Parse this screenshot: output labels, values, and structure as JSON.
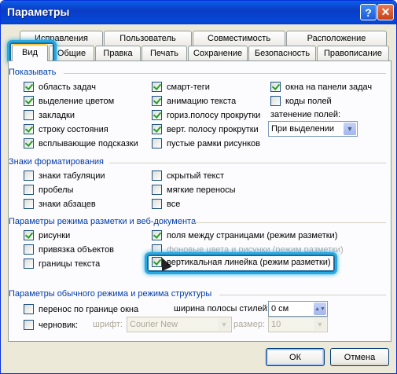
{
  "window": {
    "title": "Параметры"
  },
  "tabs_row1": [
    "Исправления",
    "Пользователь",
    "Совместимость",
    "Расположение"
  ],
  "tabs_row2": [
    "Вид",
    "Общие",
    "Правка",
    "Печать",
    "Сохранение",
    "Безопасность",
    "Правописание"
  ],
  "show": {
    "title": "Показывать",
    "col1": [
      {
        "label": "область задач",
        "checked": true
      },
      {
        "label": "выделение цветом",
        "checked": true
      },
      {
        "label": "закладки",
        "checked": false
      },
      {
        "label": "строку состояния",
        "checked": true
      },
      {
        "label": "всплывающие подсказки",
        "checked": true
      }
    ],
    "col2": [
      {
        "label": "смарт-теги",
        "checked": true
      },
      {
        "label": "анимацию текста",
        "checked": true
      },
      {
        "label": "гориз.полосу прокрутки",
        "checked": true
      },
      {
        "label": "верт. полосу прокрутки",
        "checked": true
      },
      {
        "label": "пустые рамки рисунков",
        "checked": false
      }
    ],
    "col3": [
      {
        "label": "окна на панели задач",
        "checked": true
      },
      {
        "label": "коды полей",
        "checked": false
      }
    ],
    "shading_label": "затенение полей:",
    "shading_value": "При выделении"
  },
  "format": {
    "title": "Знаки форматирования",
    "col1": [
      {
        "label": "знаки табуляции",
        "checked": false
      },
      {
        "label": "пробелы",
        "checked": false
      },
      {
        "label": "знаки абзацев",
        "checked": false
      }
    ],
    "col2": [
      {
        "label": "скрытый текст",
        "checked": false
      },
      {
        "label": "мягкие переносы",
        "checked": false
      },
      {
        "label": "все",
        "checked": false
      }
    ]
  },
  "layout": {
    "title": "Параметры режима разметки и веб-документа",
    "col1": [
      {
        "label": "рисунки",
        "checked": true
      },
      {
        "label": "привязка объектов",
        "checked": false
      },
      {
        "label": "границы текста",
        "checked": false
      }
    ],
    "col2": [
      {
        "label": "поля между страницами (режим разметки)",
        "checked": true
      },
      {
        "label": "фоновые цвета и рисунки (режим разметки)",
        "checked": false
      },
      {
        "label": "вертикальная линейка (режим разметки)",
        "checked": true
      }
    ]
  },
  "normal": {
    "title": "Параметры обычного режима и режима структуры",
    "wrap_label": "перенос по границе окна",
    "wrap_checked": false,
    "draft_label": "черновик:",
    "draft_checked": false,
    "style_width_label": "ширина полосы стилей:",
    "style_width_value": "0 см",
    "font_label": "шрифт:",
    "font_value": "Courier New",
    "size_label": "размер:",
    "size_value": "10"
  },
  "buttons": {
    "ok": "ОК",
    "cancel": "Отмена"
  },
  "colors": {
    "highlight": "#27a9e1",
    "section_title": "#003ca8",
    "titlebar": "#0a3cc4"
  }
}
